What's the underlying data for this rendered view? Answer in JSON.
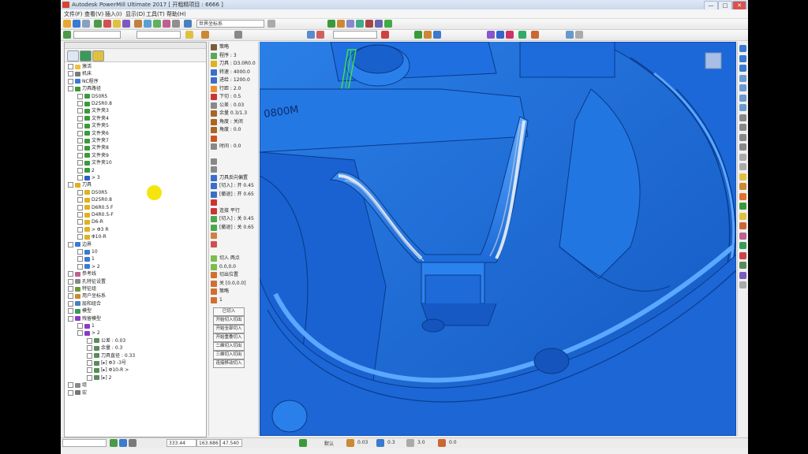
{
  "window": {
    "title": "Autodesk PowerMill Ultimate 2017  [ 开粗精项目 : 6666 ]",
    "controls": [
      "—",
      "□",
      "✕"
    ]
  },
  "menu": [
    "文件(F)",
    "查看(V)",
    "插入(I)",
    "显示(D)",
    "工具(T)",
    "帮助(H)"
  ],
  "toolbar": {
    "workplane_combo": "世界坐标系",
    "combo2": "",
    "combo3": ""
  },
  "explorer": {
    "tabs": [
      "explorer-tab",
      "globe-tab",
      "help-tab"
    ],
    "tree": [
      {
        "label": "激活",
        "indent": 0,
        "icon": "folder-icon"
      },
      {
        "label": "机床",
        "indent": 0,
        "icon": "machine-icon"
      },
      {
        "label": "NC程序",
        "indent": 0,
        "icon": "nc-program-icon"
      },
      {
        "label": "刀具路径",
        "indent": 0,
        "icon": "toolpath-folder-icon"
      },
      {
        "label": "D50R5",
        "indent": 1,
        "icon": "toolpath-icon"
      },
      {
        "label": "D25R0.8",
        "indent": 1,
        "icon": "toolpath-icon"
      },
      {
        "label": "文件夹3",
        "indent": 1,
        "icon": "toolpath-icon"
      },
      {
        "label": "文件夹4",
        "indent": 1,
        "icon": "toolpath-icon"
      },
      {
        "label": "文件夹5",
        "indent": 1,
        "icon": "toolpath-icon"
      },
      {
        "label": "文件夹6",
        "indent": 1,
        "icon": "toolpath-icon"
      },
      {
        "label": "文件夹7",
        "indent": 1,
        "icon": "toolpath-icon"
      },
      {
        "label": "文件夹8",
        "indent": 1,
        "icon": "toolpath-icon"
      },
      {
        "label": "文件夹9",
        "indent": 1,
        "icon": "toolpath-icon"
      },
      {
        "label": "文件夹10",
        "indent": 1,
        "icon": "toolpath-icon"
      },
      {
        "label": "2",
        "indent": 1,
        "icon": "toolpath-icon"
      },
      {
        "label": "> 3",
        "indent": 1,
        "icon": "active-toolpath-icon"
      },
      {
        "label": "刀具",
        "indent": 0,
        "icon": "tool-folder-icon"
      },
      {
        "label": "D50R5",
        "indent": 1,
        "icon": "tool-icon"
      },
      {
        "label": "D25R0.8",
        "indent": 1,
        "icon": "tool-icon"
      },
      {
        "label": "D6R0.5 F",
        "indent": 1,
        "icon": "tool-icon"
      },
      {
        "label": "D4R0.5-F",
        "indent": 1,
        "icon": "tool-icon"
      },
      {
        "label": "D6-R",
        "indent": 1,
        "icon": "tool-icon"
      },
      {
        "label": "> Φ3 R",
        "indent": 1,
        "icon": "tool-icon"
      },
      {
        "label": "Φ10-R",
        "indent": 1,
        "icon": "tool-icon"
      },
      {
        "label": "边界",
        "indent": 0,
        "icon": "boundary-icon"
      },
      {
        "label": "10",
        "indent": 1,
        "icon": "boundary-icon"
      },
      {
        "label": "1",
        "indent": 1,
        "icon": "boundary-icon"
      },
      {
        "label": "> 2",
        "indent": 1,
        "icon": "boundary-icon"
      },
      {
        "label": "参考线",
        "indent": 0,
        "icon": "pattern-icon"
      },
      {
        "label": "孔特征设置",
        "indent": 0,
        "icon": "hole-icon"
      },
      {
        "label": "特征组",
        "indent": 0,
        "icon": "feature-icon"
      },
      {
        "label": "用户坐标系",
        "indent": 0,
        "icon": "workplane-icon"
      },
      {
        "label": "层和组合",
        "indent": 0,
        "icon": "level-icon"
      },
      {
        "label": "模型",
        "indent": 0,
        "icon": "model-icon"
      },
      {
        "label": "残留模型",
        "indent": 0,
        "icon": "stock-model-icon"
      },
      {
        "label": "1",
        "indent": 1,
        "icon": "stock-model-icon"
      },
      {
        "label": "> 2",
        "indent": 1,
        "icon": "stock-model-icon"
      },
      {
        "label": "公差 : 0.03",
        "indent": 2,
        "icon": "param-icon"
      },
      {
        "label": "余量 : 0.3",
        "indent": 2,
        "icon": "param-icon"
      },
      {
        "label": "刀具直径 : 0.33",
        "indent": 2,
        "icon": "param-icon"
      },
      {
        "label": "[▸] Φ3 -3号",
        "indent": 2,
        "icon": "param-icon"
      },
      {
        "label": "[▸] Φ10-R >",
        "indent": 2,
        "icon": "param-icon"
      },
      {
        "label": "[▸] 2",
        "indent": 2,
        "icon": "param-icon"
      },
      {
        "label": "组",
        "indent": 0,
        "icon": "group-icon"
      },
      {
        "label": "宏",
        "indent": 0,
        "icon": "macro-icon"
      }
    ]
  },
  "infopanel": {
    "rows": [
      {
        "icon": "#7a5c3a",
        "text": "策略"
      },
      {
        "icon": "#58a858",
        "text": "程序 : 3"
      },
      {
        "icon": "#e0b020",
        "text": "刀具 : D3.0R0.0"
      },
      {
        "icon": "#3a6ec8",
        "text": "转速 : 4000.0"
      },
      {
        "icon": "#3a6ec8",
        "text": "进给 : 1200.0"
      },
      {
        "icon": "#e89030",
        "text": "行距 : 2.0"
      },
      {
        "icon": "#cc3333",
        "text": "下切 : 0.5"
      },
      {
        "icon": "#888888",
        "text": "公差 : 0.03"
      },
      {
        "icon": "#aa6622",
        "text": "余量 0.3/1.3"
      },
      {
        "icon": "#aa6622",
        "text": "角度 : 关闭"
      },
      {
        "icon": "#aa6622",
        "text": "角度 : 0.0"
      },
      {
        "icon": "#cc5522",
        "text": ""
      },
      {
        "icon": "#888888",
        "text": "时间 : 0.0"
      }
    ],
    "rows2": [
      {
        "icon": "#888888",
        "text": ""
      },
      {
        "icon": "#888888",
        "text": ""
      },
      {
        "icon": "#3a6ec8",
        "text": "刀具反向偏置"
      },
      {
        "icon": "#3a6ec8",
        "text": "[切入] : 开 0.45"
      },
      {
        "icon": "#3a6ec8",
        "text": "[撤退] : 开 0.65"
      },
      {
        "icon": "#cc3333",
        "text": ""
      },
      {
        "icon": "#cc3333",
        "text": "连接  平行"
      },
      {
        "icon": "#4aa84a",
        "text": "[切入] : 关 0.45"
      },
      {
        "icon": "#4aa84a",
        "text": "[撤退] : 关 0.65"
      },
      {
        "icon": "#d08040",
        "text": ""
      },
      {
        "icon": "#d05050",
        "text": ""
      }
    ],
    "rows3": [
      {
        "icon": "#7cbc4c",
        "text": "切入  两点"
      },
      {
        "icon": "#7cbc4c",
        "text": "0.0,0.0"
      },
      {
        "icon": "#d07030",
        "text": "切出位置"
      },
      {
        "icon": "#d07030",
        "text": "关  [0.0,0.0]"
      },
      {
        "icon": "#d07030",
        "text": "策略"
      },
      {
        "icon": "#d07030",
        "text": "1"
      }
    ],
    "buttons": [
      "已切入",
      "开始切入切出",
      "开始全部切入",
      "开始重叠切入",
      "二维切入切出",
      "三维切入切出",
      "连接移动切入"
    ]
  },
  "viewport": {
    "label": "0800M"
  },
  "status": {
    "x": "333.44",
    "y": "163.686",
    "z": "47.540",
    "zoom": "默认",
    "tol": "0.03",
    "thickness": "0.3",
    "stepover": "3.0",
    "extra": "0.0"
  }
}
